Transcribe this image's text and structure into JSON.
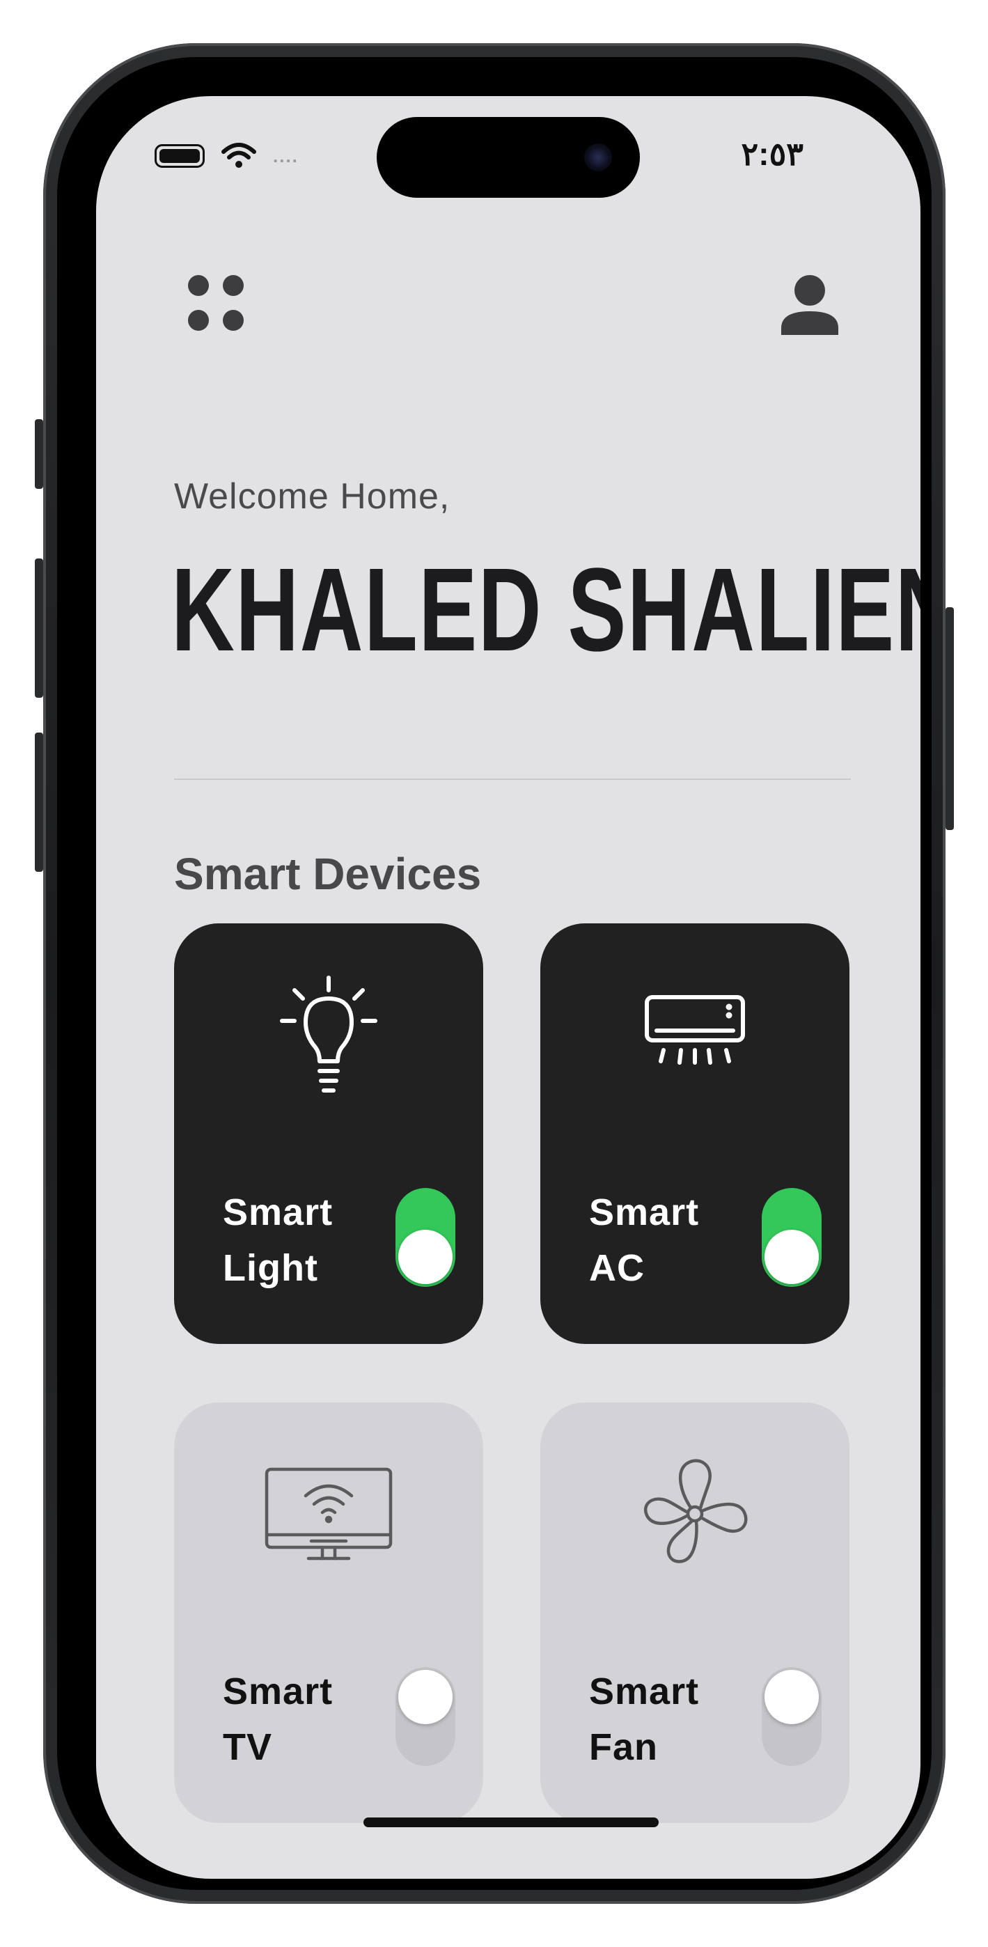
{
  "status_bar": {
    "time": "٢:٥٣",
    "signal": "....",
    "icons": [
      "battery-icon",
      "wifi-icon"
    ]
  },
  "header": {
    "menu_icon": "grid-dots-icon",
    "profile_icon": "person-icon"
  },
  "greeting": {
    "welcome": "Welcome Home,",
    "name": "KHALED SHALIEN"
  },
  "devices_section": {
    "title": "Smart Devices",
    "devices": [
      {
        "line1": "Smart",
        "line2": "Light",
        "icon": "lightbulb-icon",
        "on": true
      },
      {
        "line1": "Smart",
        "line2": "AC",
        "icon": "air-conditioner-icon",
        "on": true
      },
      {
        "line1": "Smart",
        "line2": "TV",
        "icon": "smart-tv-icon",
        "on": false
      },
      {
        "line1": "Smart",
        "line2": "Fan",
        "icon": "fan-icon",
        "on": false
      }
    ]
  },
  "colors": {
    "background": "#e2e2e4",
    "card_on": "#212121",
    "card_off": "#d3d3d7",
    "toggle_on": "#34c759",
    "toggle_off": "#c5c5c9",
    "title_text": "#1c1c1e"
  }
}
